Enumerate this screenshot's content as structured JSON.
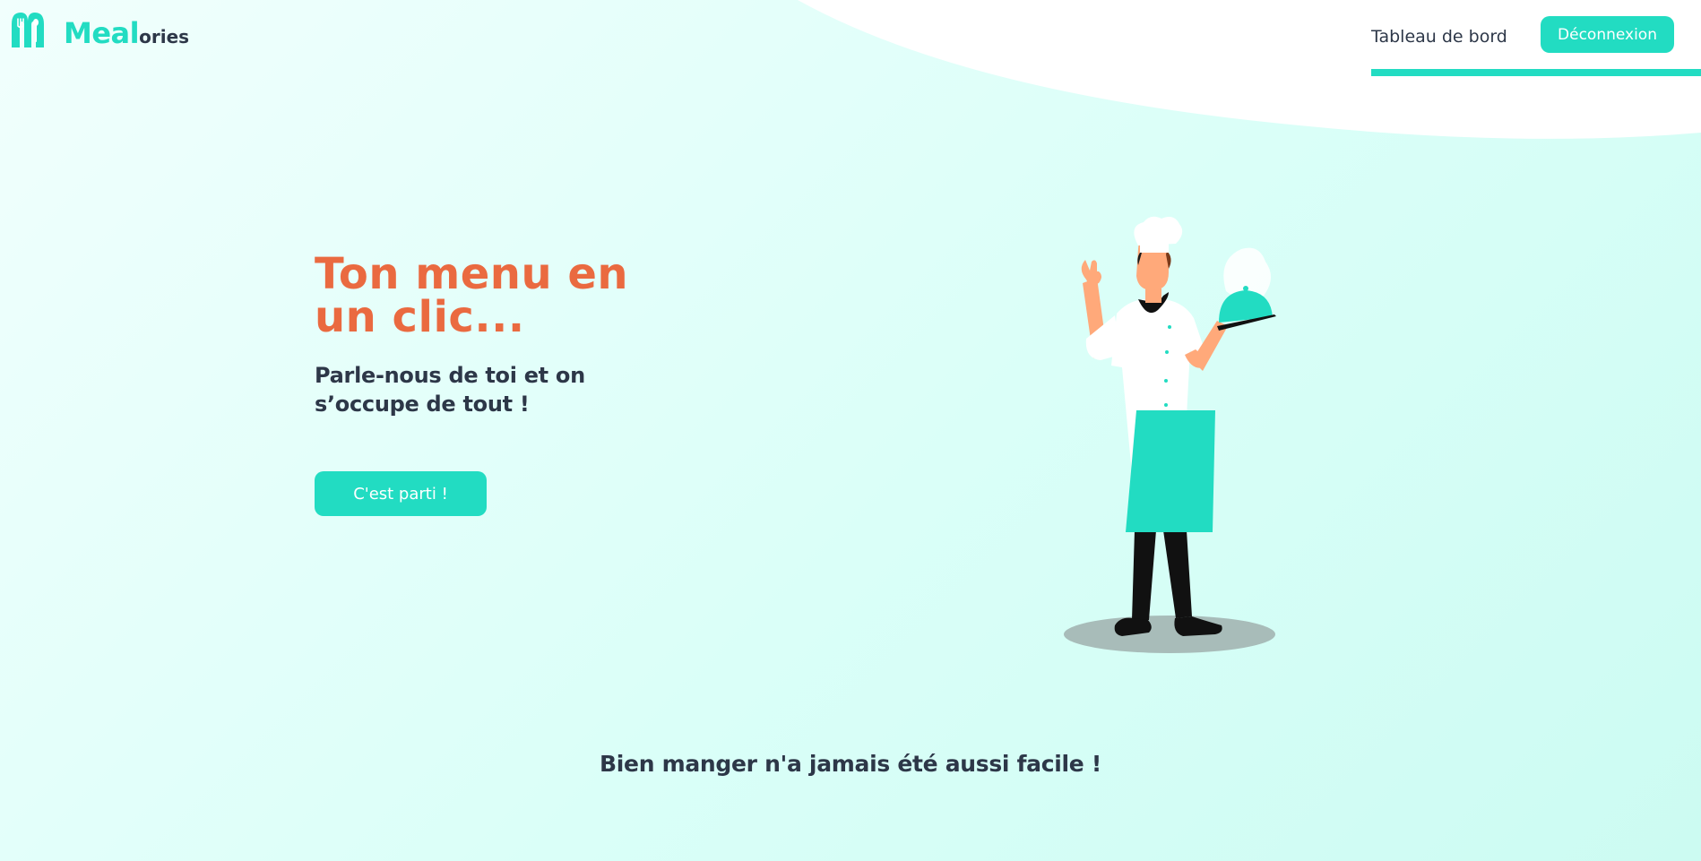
{
  "header": {
    "brand_primary": "Meal",
    "brand_secondary": "ories",
    "logo_icon": "fork-spoon-m-icon",
    "nav_dashboard_label": "Tableau de bord",
    "logout_label": "Déconnexion"
  },
  "hero": {
    "title": "Ton menu en\nun clic...",
    "subtitle": "Parle-nous de toi et on\ns’occupe de tout !",
    "cta_label": "C'est parti !",
    "illustration": "chef-holding-cloche-illustration"
  },
  "footer": {
    "tagline": "Bien manger n'a jamais été aussi facile !"
  },
  "colors": {
    "accent": "#22dcc2",
    "title": "#ea6a40",
    "text": "#2d3748",
    "background": "#e6fffb"
  }
}
